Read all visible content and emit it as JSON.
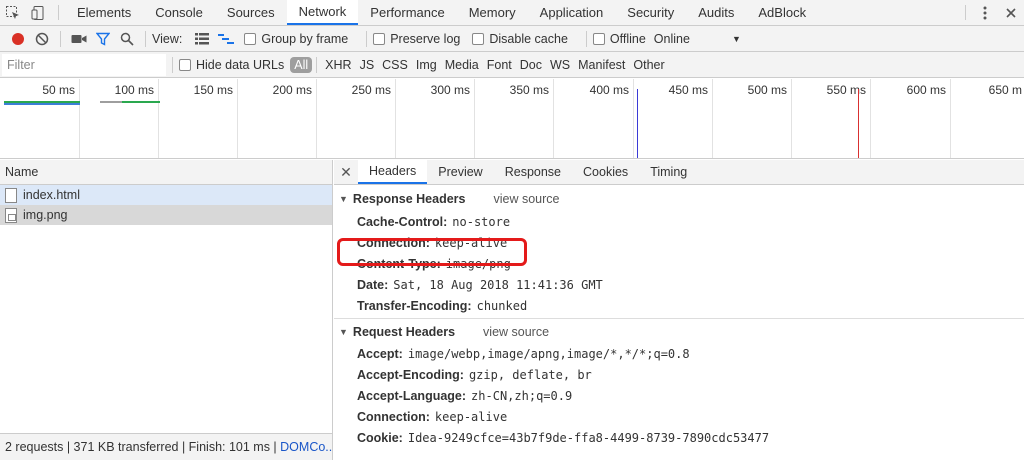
{
  "topbar": {
    "tabs": [
      "Elements",
      "Console",
      "Sources",
      "Network",
      "Performance",
      "Memory",
      "Application",
      "Security",
      "Audits",
      "AdBlock"
    ],
    "active_tab": "Network"
  },
  "toolbar": {
    "view_label": "View:",
    "group_by_frame": "Group by frame",
    "preserve_log": "Preserve log",
    "disable_cache": "Disable cache",
    "offline": "Offline",
    "throttle_value": "Online"
  },
  "filterbar": {
    "placeholder": "Filter",
    "hide_data_urls": "Hide data URLs",
    "types": [
      "All",
      "XHR",
      "JS",
      "CSS",
      "Img",
      "Media",
      "Font",
      "Doc",
      "WS",
      "Manifest",
      "Other"
    ]
  },
  "timeline": {
    "ticks": [
      "50 ms",
      "100 ms",
      "150 ms",
      "200 ms",
      "250 ms",
      "300 ms",
      "350 ms",
      "400 ms",
      "450 ms",
      "500 ms",
      "550 ms",
      "600 ms",
      "650 m"
    ],
    "colors": {
      "dom_content_loaded": "#3b3bd6",
      "load": "#d93030",
      "request_green": "#2aa84f",
      "request_blue": "#3b7fd6",
      "request_gray": "#9e9e9e"
    }
  },
  "left": {
    "header": "Name",
    "requests": [
      {
        "name": "index.html"
      },
      {
        "name": "img.png"
      }
    ],
    "status_prefix": "2 requests | 371 KB transferred | Finish: 101 ms | ",
    "status_link": "DOMCo..."
  },
  "right": {
    "tabs": [
      "Headers",
      "Preview",
      "Response",
      "Cookies",
      "Timing"
    ],
    "active_tab": "Headers",
    "response_headers": {
      "title": "Response Headers",
      "view_source": "view source",
      "rows": [
        {
          "k": "Cache-Control:",
          "v": "no-store"
        },
        {
          "k": "Connection:",
          "v": "keep-alive"
        },
        {
          "k": "Content-Type:",
          "v": "image/png"
        },
        {
          "k": "Date:",
          "v": "Sat, 18 Aug 2018 11:41:36 GMT"
        },
        {
          "k": "Transfer-Encoding:",
          "v": "chunked"
        }
      ]
    },
    "request_headers": {
      "title": "Request Headers",
      "view_source": "view source",
      "rows": [
        {
          "k": "Accept:",
          "v": "image/webp,image/apng,image/*,*/*;q=0.8"
        },
        {
          "k": "Accept-Encoding:",
          "v": "gzip, deflate, br"
        },
        {
          "k": "Accept-Language:",
          "v": "zh-CN,zh;q=0.9"
        },
        {
          "k": "Connection:",
          "v": "keep-alive"
        },
        {
          "k": "Cookie:",
          "v": "Idea-9249cfce=43b7f9de-ffa8-4499-8739-7890cdc53477"
        }
      ]
    },
    "highlight_color": "#e41a1a"
  }
}
